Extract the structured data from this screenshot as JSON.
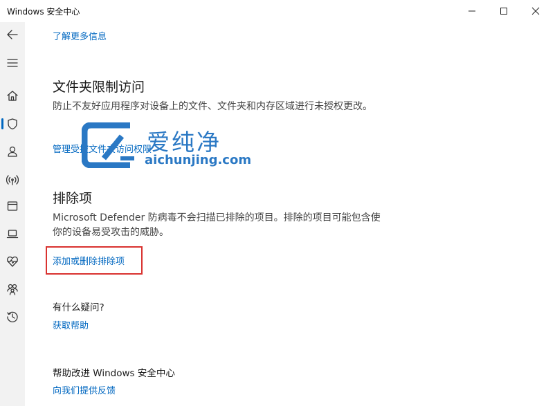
{
  "window": {
    "title": "Windows 安全中心"
  },
  "sidebar": {
    "items": [
      {
        "icon": "back-arrow-icon"
      },
      {
        "icon": "hamburger-menu-icon"
      },
      {
        "icon": "home-icon"
      },
      {
        "icon": "shield-icon",
        "selected": true
      },
      {
        "icon": "person-icon"
      },
      {
        "icon": "wireless-icon"
      },
      {
        "icon": "app-browser-icon"
      },
      {
        "icon": "laptop-icon"
      },
      {
        "icon": "heart-pulse-icon"
      },
      {
        "icon": "family-icon"
      },
      {
        "icon": "history-icon"
      }
    ],
    "accent": "#0067c0"
  },
  "main": {
    "learn_more_link": "了解更多信息",
    "folder_section": {
      "title": "文件夹限制访问",
      "description": "防止不友好应用程序对设备上的文件、文件夹和内存区域进行未授权更改。",
      "manage_link": "管理受控文件夹访问权限"
    },
    "exclusions_section": {
      "title": "排除项",
      "description": "Microsoft Defender 防病毒不会扫描已排除的项目。排除的项目可能包含使你的设备易受攻击的威胁。",
      "add_remove_link": "添加或删除排除项"
    },
    "questions_section": {
      "title": "有什么疑问?",
      "help_link": "获取帮助"
    },
    "improve_section": {
      "title": "帮助改进 Windows 安全中心",
      "feedback_link": "向我们提供反馈"
    }
  },
  "watermark": {
    "brand_text": "爱纯净",
    "url_text": "aichunjing.com",
    "color": "#2a78c4"
  },
  "highlight": {
    "color": "#d9322f"
  }
}
